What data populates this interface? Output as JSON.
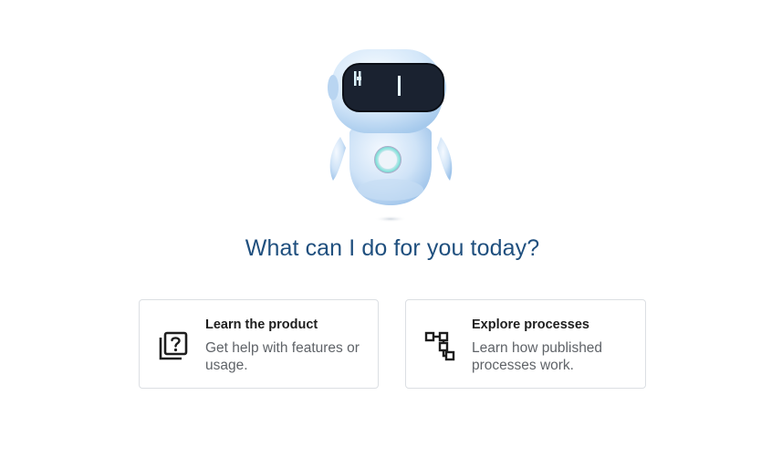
{
  "assistant": {
    "greeting": "What can I do for you today?"
  },
  "cards": [
    {
      "title": "Learn the product",
      "description": "Get help with features or usage.",
      "icon": "help-book-icon"
    },
    {
      "title": "Explore processes",
      "description": "Learn how published processes work.",
      "icon": "process-flow-icon"
    }
  ],
  "colors": {
    "heading": "#1f4f7e",
    "card_border": "#dcdfe3",
    "description": "#5f6368"
  }
}
